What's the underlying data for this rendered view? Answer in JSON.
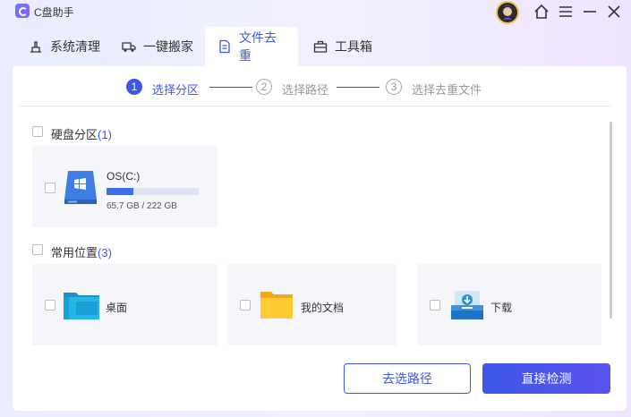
{
  "app": {
    "title": "C盘助手"
  },
  "tabs": [
    {
      "label": "系统清理",
      "icon": "broom-icon"
    },
    {
      "label": "一键搬家",
      "icon": "truck-icon"
    },
    {
      "label": "文件去重",
      "icon": "document-icon",
      "active": true
    },
    {
      "label": "工具箱",
      "icon": "toolbox-icon"
    }
  ],
  "stepper": [
    {
      "num": "1",
      "label": "选择分区",
      "active": true
    },
    {
      "num": "2",
      "label": "选择路径",
      "active": false
    },
    {
      "num": "3",
      "label": "选择去重文件",
      "active": false
    }
  ],
  "disk_section": {
    "title": "硬盘分区",
    "count": "(1)",
    "drive": {
      "name": "OS(C:)",
      "size": "65.7 GB / 222 GB",
      "usage_fraction": 0.296
    }
  },
  "common_section": {
    "title": "常用位置",
    "count": "(3)",
    "items": [
      {
        "label": "桌面",
        "icon": "desktop-folder-icon"
      },
      {
        "label": "我的文档",
        "icon": "documents-folder-icon"
      },
      {
        "label": "下载",
        "icon": "download-folder-icon"
      }
    ]
  },
  "buttons": {
    "choose_path": "去选路径",
    "direct_scan": "直接检测"
  },
  "colors": {
    "accent": "#3d57e6",
    "arrow": "#e63a2e"
  }
}
